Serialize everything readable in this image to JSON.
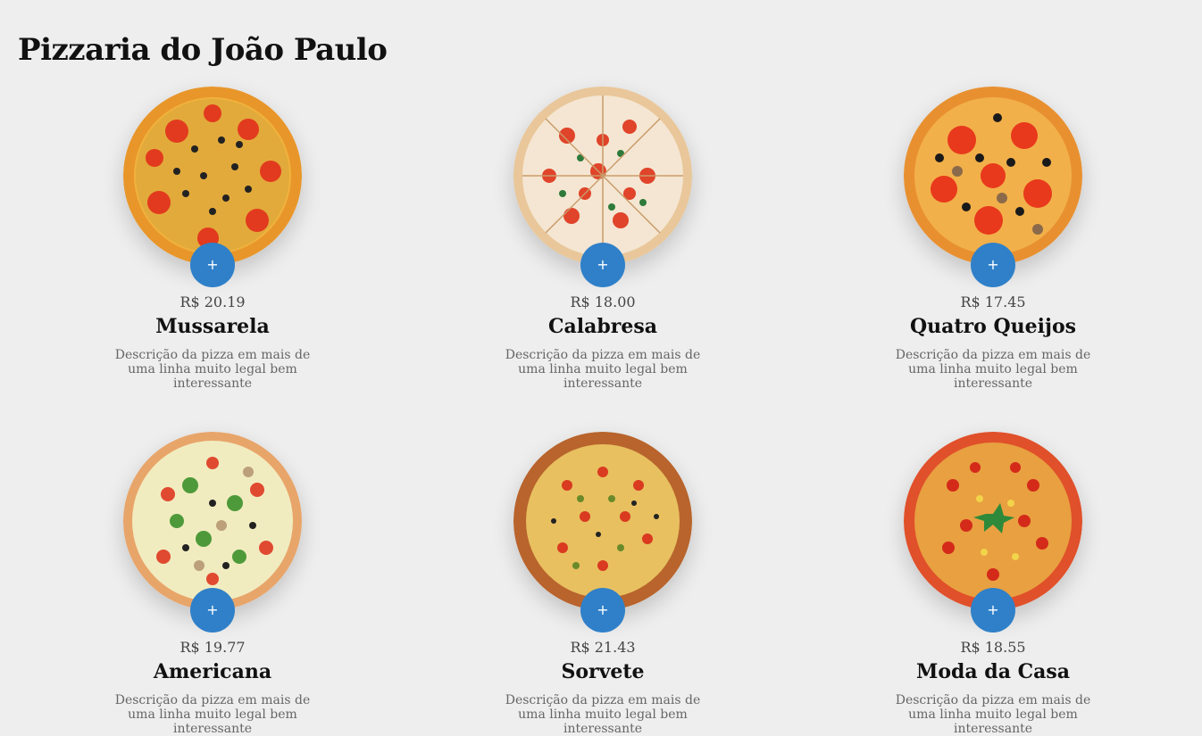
{
  "header": {
    "title": "Pizzaria do João Paulo"
  },
  "add_label": "+",
  "pizzas": [
    {
      "price": "R$ 20.19",
      "name": "Mussarela",
      "description": "Descrição da pizza em mais de uma linha muito legal bem interessante"
    },
    {
      "price": "R$ 18.00",
      "name": "Calabresa",
      "description": "Descrição da pizza em mais de uma linha muito legal bem interessante"
    },
    {
      "price": "R$ 17.45",
      "name": "Quatro Queijos",
      "description": "Descrição da pizza em mais de uma linha muito legal bem interessante"
    },
    {
      "price": "R$ 19.77",
      "name": "Americana",
      "description": "Descrição da pizza em mais de uma linha muito legal bem interessante"
    },
    {
      "price": "R$ 21.43",
      "name": "Sorvete",
      "description": "Descrição da pizza em mais de uma linha muito legal bem interessante"
    },
    {
      "price": "R$ 18.55",
      "name": "Moda da Casa",
      "description": "Descrição da pizza em mais de uma linha muito legal bem interessante"
    }
  ],
  "colors": {
    "background": "#eeeeee",
    "accent": "#2f80c9",
    "title": "#111111"
  }
}
